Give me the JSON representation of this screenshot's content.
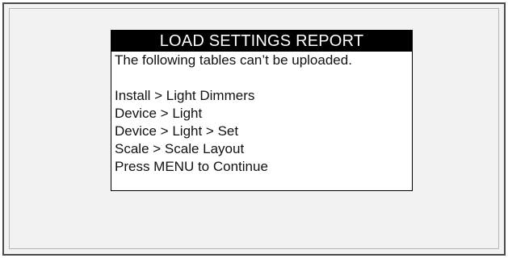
{
  "dialog": {
    "title": "LOAD SETTINGS REPORT",
    "message": "The following tables can’t be uploaded.",
    "tables": [
      "Install > Light Dimmers",
      "Device > Light",
      "Device > Light > Set",
      "Scale > Scale Layout"
    ],
    "prompt": "Press MENU to Continue"
  }
}
